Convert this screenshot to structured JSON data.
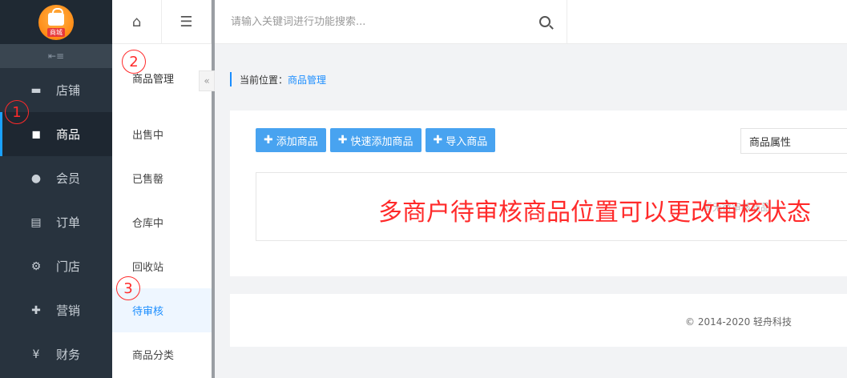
{
  "app": {
    "logo_tag": "商城"
  },
  "sidebar": {
    "collapse_icon": "collapse-left-icon",
    "items": [
      {
        "label": "店铺",
        "icon": "store-icon"
      },
      {
        "label": "商品",
        "icon": "bag-icon",
        "active": true
      },
      {
        "label": "会员",
        "icon": "user-icon"
      },
      {
        "label": "订单",
        "icon": "document-icon"
      },
      {
        "label": "门店",
        "icon": "shop-settings-icon"
      },
      {
        "label": "营销",
        "icon": "gift-icon"
      },
      {
        "label": "财务",
        "icon": "money-bag-icon"
      }
    ]
  },
  "subnav": {
    "title": "商品管理",
    "items": [
      {
        "label": "出售中"
      },
      {
        "label": "已售罄"
      },
      {
        "label": "仓库中"
      },
      {
        "label": "回收站"
      },
      {
        "label": "待审核",
        "active": true
      },
      {
        "label": "商品分类"
      }
    ]
  },
  "topbar": {
    "search_placeholder": "请输入关键词进行功能搜索..."
  },
  "breadcrumb": {
    "prefix": "当前位置：",
    "current": "商品管理"
  },
  "toolbar": {
    "add_label": "添加商品",
    "quick_add_label": "快速添加商品",
    "import_label": "导入商品",
    "attr_select_value": "商品属性"
  },
  "table": {
    "empty_text": "暂无待审核商品"
  },
  "footer": {
    "copyright": "© 2014-2020 轻舟科技"
  },
  "annotations": {
    "note": "多商户待审核商品位置可以更改审核状态",
    "marker_1": "1",
    "marker_2": "2",
    "marker_3": "3"
  },
  "colors": {
    "accent": "#1a8dff",
    "button": "#48a3f0",
    "sidebar_bg": "#28333e",
    "annotation": "#ff2a2a"
  }
}
